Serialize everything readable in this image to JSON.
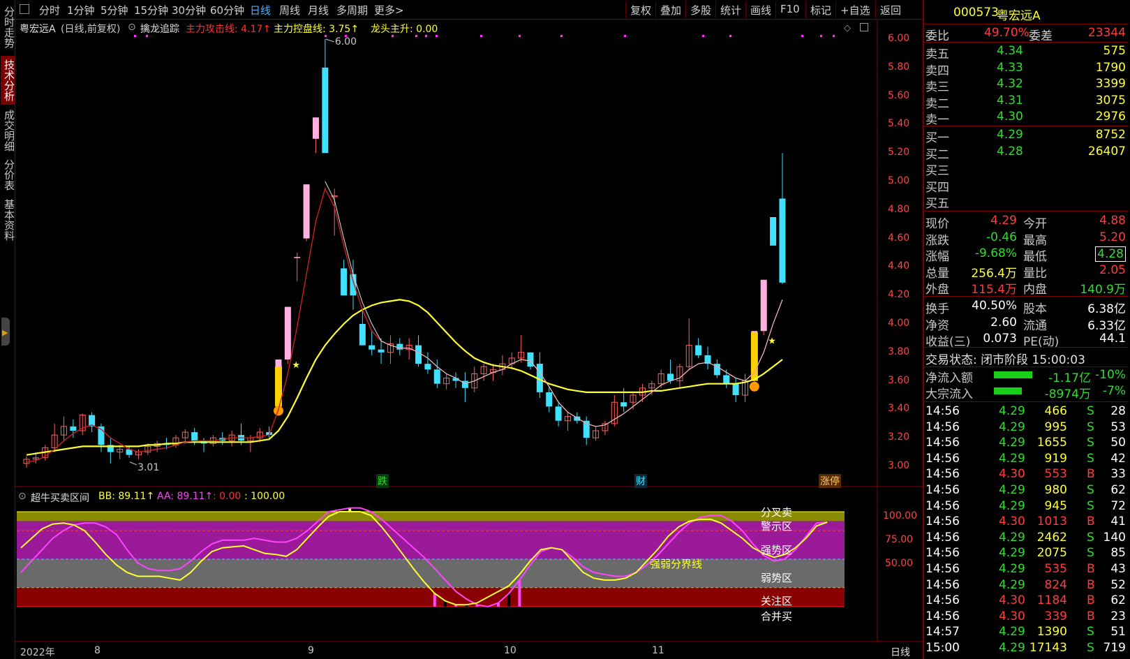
{
  "left_tabs": [
    "分时走势",
    "技术分析",
    "成交明细",
    "分价表",
    "基本资料"
  ],
  "toolbar": {
    "periods": [
      "分时",
      "1分钟",
      "5分钟",
      "15分钟",
      "30分钟",
      "60分钟",
      "日线",
      "周线",
      "月线",
      "多周期",
      "更多>"
    ],
    "selected": "日线",
    "right_buttons": [
      "复权",
      "叠加",
      "多股",
      "统计",
      "画线",
      "F10",
      "标记",
      "+自选",
      "返回"
    ]
  },
  "main_info": {
    "stock": "粤宏远A",
    "mode": "(日线,前复权)",
    "indicator": "擒龙追踪",
    "l1": "主力攻击线: 4.17↑",
    "l2": "主力控盘线: 3.75↑",
    "l3": "龙头主升: 0.00"
  },
  "price_ticks": [
    "6.00",
    "5.80",
    "5.60",
    "5.40",
    "5.20",
    "5.00",
    "4.80",
    "4.60",
    "4.40",
    "4.20",
    "4.00",
    "3.80",
    "3.60",
    "3.40",
    "3.20",
    "3.00"
  ],
  "annotations": {
    "high": "6.00",
    "low": "3.01",
    "m1": "跌",
    "m2": "财",
    "m3": "涨停"
  },
  "sub_info": {
    "name": "超牛买卖区间",
    "bb": "BB: 89.11↑",
    "aa": "AA: 89.11↑",
    "v1": ": 0.00",
    "v2": ": 100.00"
  },
  "sub_ticks": [
    "100.00",
    "75.00",
    "50.00"
  ],
  "zones": {
    "fencha": "分叉卖",
    "jingshi": "警示区",
    "qiangshi": "强势区",
    "qiangruo": "强弱分界线",
    "ruoshi": "弱势区",
    "guanzhu": "关注区",
    "hebing": "合并买"
  },
  "x_labels": [
    "2022年",
    "8",
    "9",
    "10",
    "11"
  ],
  "period_label": "日线",
  "quote": {
    "code": "000573",
    "name": "粤宏远A",
    "weibi_label": "委比",
    "weibi": "49.70%",
    "weicha_label": "委差",
    "weicha": "23344",
    "asks": [
      [
        "卖五",
        "4.34",
        "575"
      ],
      [
        "卖四",
        "4.33",
        "1790"
      ],
      [
        "卖三",
        "4.32",
        "3399"
      ],
      [
        "卖二",
        "4.31",
        "3075"
      ],
      [
        "卖一",
        "4.30",
        "2976"
      ]
    ],
    "bids": [
      [
        "买一",
        "4.29",
        "8752"
      ],
      [
        "买二",
        "4.28",
        "26407"
      ],
      [
        "买三",
        "",
        ""
      ],
      [
        "买四",
        "",
        ""
      ],
      [
        "买五",
        "",
        ""
      ]
    ],
    "stats": [
      [
        "现价",
        "4.29",
        "今开",
        "4.88"
      ],
      [
        "涨跌",
        "-0.46",
        "最高",
        "5.20"
      ],
      [
        "涨幅",
        "-9.68%",
        "最低",
        "4.28"
      ],
      [
        "总量",
        "256.4万",
        "量比",
        "2.05"
      ],
      [
        "外盘",
        "115.4万",
        "内盘",
        "140.9万"
      ]
    ],
    "fund": [
      [
        "换手",
        "40.50%",
        "股本",
        "6.38亿"
      ],
      [
        "净资",
        "2.60",
        "流通",
        "6.33亿"
      ],
      [
        "收益(三)",
        "0.073",
        "PE(动)",
        "44.1"
      ]
    ],
    "status": "交易状态: 闭市阶段 15:00:03",
    "flows": [
      [
        "净流入额",
        "-1.17亿",
        "-10%"
      ],
      [
        "大宗流入",
        "-8974万",
        "-7%"
      ]
    ],
    "ticks": [
      [
        "14:56",
        "4.29",
        "466",
        "S",
        "28"
      ],
      [
        "14:56",
        "4.29",
        "995",
        "S",
        "53"
      ],
      [
        "14:56",
        "4.29",
        "1655",
        "S",
        "50"
      ],
      [
        "14:56",
        "4.29",
        "919",
        "S",
        "42"
      ],
      [
        "14:56",
        "4.30",
        "553",
        "B",
        "33"
      ],
      [
        "14:56",
        "4.29",
        "980",
        "S",
        "62"
      ],
      [
        "14:56",
        "4.29",
        "945",
        "S",
        "72"
      ],
      [
        "14:56",
        "4.30",
        "1013",
        "B",
        "41"
      ],
      [
        "14:56",
        "4.29",
        "2462",
        "S",
        "140"
      ],
      [
        "14:56",
        "4.29",
        "2075",
        "S",
        "85"
      ],
      [
        "14:56",
        "4.29",
        "535",
        "B",
        "43"
      ],
      [
        "14:56",
        "4.29",
        "824",
        "B",
        "52"
      ],
      [
        "14:56",
        "4.30",
        "1184",
        "B",
        "62"
      ],
      [
        "14:56",
        "4.30",
        "339",
        "B",
        "23"
      ],
      [
        "14:57",
        "4.29",
        "1390",
        "S",
        "51"
      ],
      [
        "15:00",
        "4.29",
        "17143",
        "S",
        "719"
      ]
    ]
  },
  "chart_data": {
    "type": "candlestick",
    "price_axis": [
      3.0,
      6.0
    ],
    "candles": [
      [
        3.02,
        3.07,
        2.99,
        3.05
      ],
      [
        3.05,
        3.1,
        3.02,
        3.06
      ],
      [
        3.06,
        3.15,
        3.04,
        3.13
      ],
      [
        3.13,
        3.3,
        3.1,
        3.22
      ],
      [
        3.22,
        3.35,
        3.18,
        3.28
      ],
      [
        3.28,
        3.33,
        3.2,
        3.25
      ],
      [
        3.25,
        3.37,
        3.22,
        3.36
      ],
      [
        3.36,
        3.38,
        3.24,
        3.28
      ],
      [
        3.28,
        3.3,
        3.1,
        3.15
      ],
      [
        3.15,
        3.2,
        3.02,
        3.1
      ],
      [
        3.1,
        3.15,
        3.05,
        3.12
      ],
      [
        3.12,
        3.14,
        3.06,
        3.08
      ],
      [
        3.08,
        3.12,
        3.05,
        3.1
      ],
      [
        3.1,
        3.16,
        3.08,
        3.14
      ],
      [
        3.14,
        3.18,
        3.1,
        3.16
      ],
      [
        3.16,
        3.2,
        3.12,
        3.15
      ],
      [
        3.15,
        3.22,
        3.13,
        3.2
      ],
      [
        3.2,
        3.26,
        3.16,
        3.24
      ],
      [
        3.24,
        3.27,
        3.15,
        3.18
      ],
      [
        3.18,
        3.2,
        3.1,
        3.16
      ],
      [
        3.16,
        3.22,
        3.14,
        3.2
      ],
      [
        3.2,
        3.24,
        3.15,
        3.18
      ],
      [
        3.18,
        3.25,
        3.14,
        3.22
      ],
      [
        3.22,
        3.3,
        3.15,
        3.18
      ],
      [
        3.18,
        3.22,
        3.1,
        3.2
      ],
      [
        3.2,
        3.27,
        3.17,
        3.24
      ],
      [
        3.24,
        3.28,
        3.2,
        3.22
      ],
      [
        3.45,
        3.75,
        3.42,
        3.75
      ],
      [
        3.75,
        4.12,
        3.72,
        4.12
      ],
      [
        4.47,
        4.5,
        4.3,
        4.47
      ],
      [
        4.6,
        4.98,
        4.58,
        4.98
      ],
      [
        5.3,
        5.45,
        5.2,
        5.45
      ],
      [
        5.8,
        6.0,
        5.4,
        5.2
      ],
      [
        4.9,
        4.95,
        4.62,
        4.9
      ],
      [
        4.39,
        4.45,
        4.2,
        4.2
      ],
      [
        4.35,
        4.45,
        4.1,
        4.2
      ],
      [
        4.0,
        4.1,
        3.85,
        3.85
      ],
      [
        3.85,
        3.95,
        3.78,
        3.82
      ],
      [
        3.82,
        3.9,
        3.72,
        3.8
      ],
      [
        3.8,
        3.92,
        3.72,
        3.86
      ],
      [
        3.86,
        3.9,
        3.78,
        3.82
      ],
      [
        3.82,
        3.9,
        3.75,
        3.85
      ],
      [
        3.85,
        3.92,
        3.7,
        3.72
      ],
      [
        3.72,
        3.8,
        3.65,
        3.68
      ],
      [
        3.68,
        3.75,
        3.55,
        3.58
      ],
      [
        3.58,
        3.65,
        3.54,
        3.62
      ],
      [
        3.62,
        3.66,
        3.55,
        3.6
      ],
      [
        3.6,
        3.66,
        3.45,
        3.55
      ],
      [
        3.55,
        3.7,
        3.52,
        3.65
      ],
      [
        3.65,
        3.72,
        3.6,
        3.7
      ],
      [
        3.66,
        3.72,
        3.6,
        3.68
      ],
      [
        3.68,
        3.78,
        3.64,
        3.72
      ],
      [
        3.72,
        3.8,
        3.68,
        3.76
      ],
      [
        3.76,
        3.92,
        3.73,
        3.8
      ],
      [
        3.8,
        3.8,
        3.68,
        3.7
      ],
      [
        3.72,
        3.8,
        3.48,
        3.52
      ],
      [
        3.52,
        3.56,
        3.38,
        3.42
      ],
      [
        3.42,
        3.46,
        3.28,
        3.32
      ],
      [
        3.32,
        3.38,
        3.25,
        3.35
      ],
      [
        3.35,
        3.38,
        3.3,
        3.32
      ],
      [
        3.32,
        3.35,
        3.15,
        3.2
      ],
      [
        3.2,
        3.28,
        3.18,
        3.25
      ],
      [
        3.25,
        3.32,
        3.22,
        3.3
      ],
      [
        3.3,
        3.5,
        3.28,
        3.45
      ],
      [
        3.45,
        3.55,
        3.38,
        3.42
      ],
      [
        3.45,
        3.52,
        3.4,
        3.5
      ],
      [
        3.5,
        3.58,
        3.45,
        3.55
      ],
      [
        3.55,
        3.6,
        3.5,
        3.58
      ],
      [
        3.58,
        3.68,
        3.55,
        3.65
      ],
      [
        3.65,
        3.75,
        3.58,
        3.6
      ],
      [
        3.6,
        3.72,
        3.55,
        3.7
      ],
      [
        3.7,
        4.04,
        3.68,
        3.85
      ],
      [
        3.85,
        3.9,
        3.76,
        3.78
      ],
      [
        3.78,
        3.84,
        3.68,
        3.72
      ],
      [
        3.72,
        3.75,
        3.62,
        3.64
      ],
      [
        3.64,
        3.68,
        3.55,
        3.58
      ],
      [
        3.58,
        3.62,
        3.45,
        3.5
      ],
      [
        3.5,
        3.65,
        3.45,
        3.6
      ],
      [
        3.6,
        3.95,
        3.58,
        3.95
      ],
      [
        3.95,
        4.31,
        3.92,
        4.31
      ],
      [
        4.75,
        4.75,
        4.55,
        4.55
      ],
      [
        4.88,
        5.2,
        4.28,
        4.29
      ]
    ],
    "ma_attack": [
      3.03,
      3.04,
      3.07,
      3.12,
      3.18,
      3.23,
      3.27,
      3.29,
      3.26,
      3.2,
      3.16,
      3.12,
      3.1,
      3.11,
      3.12,
      3.13,
      3.15,
      3.17,
      3.18,
      3.18,
      3.18,
      3.19,
      3.2,
      3.2,
      3.2,
      3.21,
      3.22,
      3.4,
      3.65,
      3.98,
      4.35,
      4.72,
      4.95,
      4.82,
      4.55,
      4.3,
      4.1,
      3.95,
      3.88,
      3.85,
      3.83,
      3.83,
      3.8,
      3.76,
      3.7,
      3.65,
      3.62,
      3.58,
      3.6,
      3.63,
      3.66,
      3.68,
      3.72,
      3.75,
      3.74,
      3.66,
      3.56,
      3.45,
      3.38,
      3.34,
      3.3,
      3.28,
      3.29,
      3.33,
      3.37,
      3.42,
      3.47,
      3.52,
      3.57,
      3.6,
      3.62,
      3.68,
      3.72,
      3.73,
      3.7,
      3.66,
      3.62,
      3.6,
      3.66,
      3.8,
      4.0,
      4.17
    ],
    "ma_control": [
      3.08,
      3.09,
      3.1,
      3.11,
      3.12,
      3.13,
      3.14,
      3.14,
      3.14,
      3.14,
      3.14,
      3.14,
      3.14,
      3.15,
      3.15,
      3.16,
      3.16,
      3.17,
      3.17,
      3.17,
      3.17,
      3.17,
      3.17,
      3.17,
      3.17,
      3.18,
      3.19,
      3.25,
      3.35,
      3.48,
      3.62,
      3.75,
      3.85,
      3.93,
      4.0,
      4.06,
      4.1,
      4.13,
      4.15,
      4.16,
      4.17,
      4.16,
      4.13,
      4.08,
      4.01,
      3.94,
      3.87,
      3.81,
      3.76,
      3.73,
      3.71,
      3.7,
      3.69,
      3.67,
      3.64,
      3.61,
      3.58,
      3.56,
      3.54,
      3.53,
      3.52,
      3.52,
      3.52,
      3.52,
      3.52,
      3.52,
      3.52,
      3.53,
      3.53,
      3.54,
      3.55,
      3.56,
      3.57,
      3.58,
      3.58,
      3.58,
      3.58,
      3.59,
      3.61,
      3.65,
      3.7,
      3.75
    ],
    "osc_bb": [
      62,
      72,
      82,
      87,
      88,
      86,
      80,
      68,
      55,
      44,
      36,
      32,
      32,
      32,
      30,
      28,
      36,
      48,
      58,
      62,
      63,
      64,
      60,
      56,
      55,
      53,
      60,
      72,
      84,
      95,
      100,
      100,
      100,
      96,
      84,
      70,
      55,
      40,
      26,
      14,
      6,
      2,
      2,
      4,
      10,
      16,
      22,
      34,
      48,
      60,
      62,
      60,
      48,
      36,
      30,
      28,
      28,
      30,
      36,
      48,
      60,
      74,
      84,
      90,
      92,
      92,
      88,
      80,
      72,
      62,
      56,
      52,
      55,
      62,
      72,
      85,
      89
    ],
    "osc_aa": [
      36,
      48,
      60,
      72,
      80,
      86,
      88,
      88,
      84,
      76,
      60,
      46,
      40,
      38,
      38,
      40,
      48,
      58,
      66,
      70,
      70,
      70,
      72,
      70,
      68,
      68,
      72,
      80,
      90,
      100,
      102,
      104,
      104,
      100,
      92,
      82,
      72,
      62,
      52,
      40,
      28,
      16,
      8,
      2,
      0,
      4,
      14,
      28,
      44,
      58,
      62,
      60,
      52,
      42,
      36,
      34,
      32,
      32,
      36,
      44,
      54,
      66,
      78,
      88,
      94,
      96,
      96,
      90,
      80,
      66,
      54,
      48,
      50,
      60,
      74,
      88,
      89
    ]
  }
}
